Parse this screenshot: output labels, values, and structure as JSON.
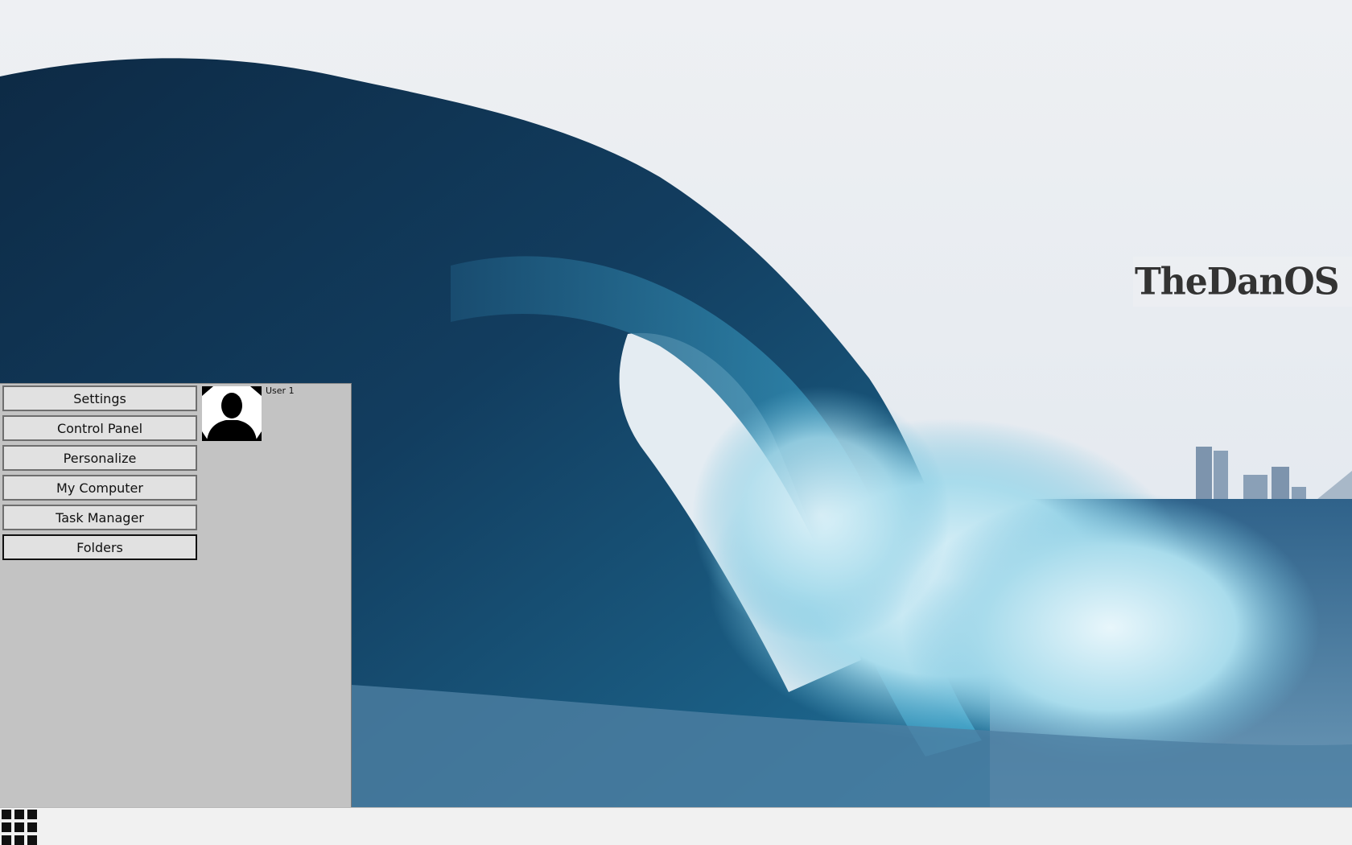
{
  "desktop": {
    "brand_text": "TheDanOS"
  },
  "start_menu": {
    "items": [
      {
        "label": "Settings"
      },
      {
        "label": "Control Panel"
      },
      {
        "label": "Personalize"
      },
      {
        "label": "My Computer"
      },
      {
        "label": "Task Manager"
      },
      {
        "label": "Folders"
      }
    ],
    "user": {
      "name": "User 1",
      "avatar_icon": "user-silhouette-icon"
    }
  },
  "taskbar": {
    "start_icon": "grid-menu-icon"
  },
  "colors": {
    "menu_background": "#c3c3c3",
    "button_background": "#e1e1e1",
    "taskbar_background": "#f1f1f1"
  }
}
